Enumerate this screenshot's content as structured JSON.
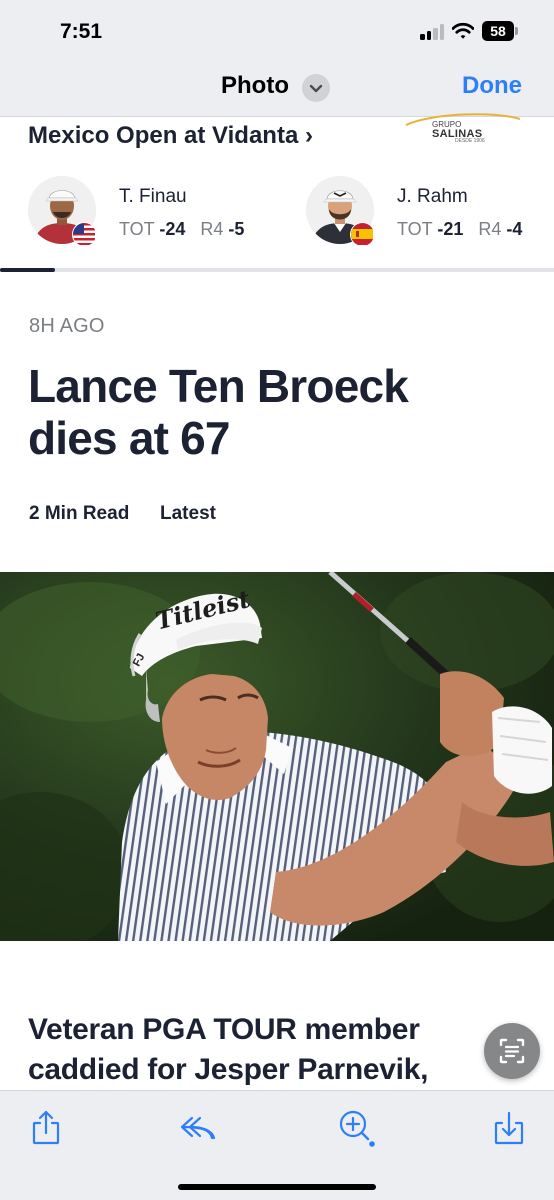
{
  "status_bar": {
    "time": "7:51",
    "battery": "58",
    "icons": [
      "signal-icon",
      "wifi-icon",
      "battery-icon"
    ]
  },
  "nav": {
    "title": "Photo",
    "done_label": "Done",
    "chevron_icon": "chevron-down-icon"
  },
  "tournament": {
    "title": "Mexico Open at Vidanta ›",
    "sponsor": {
      "line1": "GRUPO",
      "line2": "SALINAS",
      "line3": "DESDE 1906"
    },
    "players": [
      {
        "name": "T. Finau",
        "tot_label": "TOT",
        "tot_value": "-24",
        "round_label": "R4",
        "round_value": "-5",
        "flag": "usa-flag-icon"
      },
      {
        "name": "J. Rahm",
        "tot_label": "TOT",
        "tot_value": "-21",
        "round_label": "R4",
        "round_value": "-4",
        "flag": "spain-flag-icon"
      }
    ],
    "scroll_progress": 0.1
  },
  "article": {
    "time_ago": "8H AGO",
    "headline_line1": "Lance Ten Broeck",
    "headline_line2": "dies at 67",
    "read_time": "2 Min Read",
    "category": "Latest",
    "cap_logo_text": "Titleist",
    "cap_side_text": "FJ",
    "subhead_line1": "Veteran PGA TOUR member",
    "subhead_line2": "caddied for Jesper Parnevik,"
  },
  "colors": {
    "accent": "#2d7ff9",
    "headline": "#1c2233",
    "muted": "#7b7e86",
    "chrome": "#eceef2"
  },
  "toolbar": {
    "icons": [
      "share-icon",
      "markup-icon",
      "zoom-icon",
      "save-icon"
    ]
  },
  "fab_icon": "live-text-icon"
}
